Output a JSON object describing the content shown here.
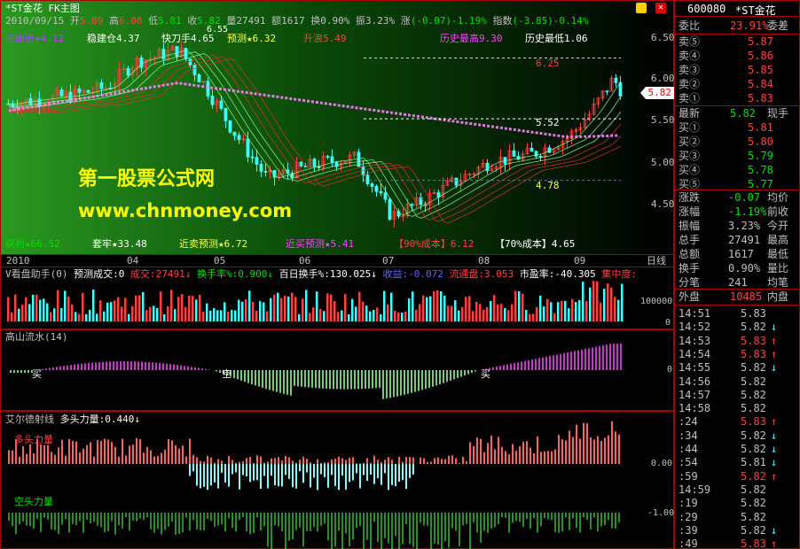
{
  "header": {
    "stock_name": "*ST金花",
    "chart_type": "FK主图",
    "date": "2010/09/15",
    "open_label": "开",
    "open": "5.89",
    "high_label": "高",
    "high": "6.00",
    "low_label": "低",
    "low": "5.81",
    "close_label": "收",
    "close": "5.82",
    "volume_label": "量",
    "volume": "27491",
    "amount_label": "额",
    "amount": "1617",
    "turnover_label": "换",
    "turnover": "0.90%",
    "amplitude_label": "振",
    "amplitude": "3.23%",
    "change_label": "涨",
    "change": "(-0.07)-1.19%",
    "index_label": "指数",
    "index_change": "(-3.85)-0.14%"
  },
  "indicators_row": [
    {
      "text": "底出击★4.12",
      "color": "#b040ff"
    },
    {
      "text": "稳建仓4.37",
      "color": "#ffffff"
    },
    {
      "text": "快刀手4.65",
      "color": "#ffffff"
    },
    {
      "text": "预测★6.32",
      "color": "#ffff40"
    },
    {
      "text": "升浪5.49",
      "color": "#ff4040"
    },
    {
      "text": "历史最高9.30",
      "color": "#ff40ff"
    },
    {
      "text": "历史最低1.06",
      "color": "#ffffff"
    }
  ],
  "bottom_indicators": [
    {
      "text": "获利★66.52",
      "color": "#00e000"
    },
    {
      "text": "套牢★33.48",
      "color": "#ffffff"
    },
    {
      "text": "近卖预测★6.72",
      "color": "#ffff40"
    },
    {
      "text": "近买预测★5.41",
      "color": "#ff40ff"
    },
    {
      "text": "【90%成本】6.12",
      "color": "#ff4040"
    },
    {
      "text": "【70%成本】4.65",
      "color": "#ffffff"
    }
  ],
  "main_chart": {
    "price_ticks": [
      "6.50",
      "6.00",
      "5.50",
      "5.00",
      "4.50"
    ],
    "level_labels": [
      "6.25",
      "5.52",
      "4.78"
    ],
    "top_tick": "6.55",
    "current_price_tag": "5.82",
    "watermark_line1": "第一股票公式网",
    "watermark_line2": "www.chnmoney.com"
  },
  "time_axis": {
    "labels": [
      "2010",
      "04",
      "05",
      "06",
      "07",
      "08",
      "09"
    ],
    "period": "日线"
  },
  "volume_panel": {
    "title_parts": [
      {
        "text": "V看盘助手(0)",
        "color": "#c0c0c0"
      },
      {
        "text": "预测成交:0",
        "color": "#ffffff"
      },
      {
        "text": "成交:27491↓",
        "color": "#ff4040"
      },
      {
        "text": "换手率%:0.900↓",
        "color": "#00e000"
      },
      {
        "text": "百日换手%:130.025↓",
        "color": "#ffffff"
      },
      {
        "text": "收益:-0.072",
        "color": "#6060ff"
      },
      {
        "text": "流通盘:3.053",
        "color": "#ff4040"
      },
      {
        "text": "市盈率:-40.305",
        "color": "#ffffff"
      },
      {
        "text": "集中度:",
        "color": "#ff4040"
      }
    ],
    "ticks": [
      "100000",
      "0"
    ]
  },
  "gaoshan_panel": {
    "title": "高山流水(14)",
    "labels": [
      "买",
      "空",
      "买"
    ],
    "tick": "0"
  },
  "elder_panel": {
    "title": "艾尔德射线",
    "value_label": "多头力量:0.440↓",
    "bull_label": "多头力量",
    "bear_label": "空头力量",
    "ticks": [
      "0.00",
      "-1.00"
    ]
  },
  "side_panel": {
    "code": "600080",
    "name": "*ST金花",
    "weibi_label": "委比",
    "weibi": "23.91%",
    "weicha_label": "委差",
    "sell_levels": [
      {
        "label": "卖⑤",
        "price": "5.87"
      },
      {
        "label": "卖④",
        "price": "5.86"
      },
      {
        "label": "卖③",
        "price": "5.85"
      },
      {
        "label": "卖②",
        "price": "5.84"
      },
      {
        "label": "卖①",
        "price": "5.83"
      }
    ],
    "latest_label": "最新",
    "latest": "5.82",
    "xianshou_label": "现手",
    "buy_levels": [
      {
        "label": "买①",
        "price": "5.81"
      },
      {
        "label": "买②",
        "price": "5.80"
      },
      {
        "label": "买③",
        "price": "5.79"
      },
      {
        "label": "买④",
        "price": "5.78"
      },
      {
        "label": "买⑤",
        "price": "5.77"
      }
    ],
    "stats": [
      {
        "label": "涨跌",
        "value": "-0.07",
        "right": "均价",
        "vcolor": "#00e000"
      },
      {
        "label": "涨幅",
        "value": "-1.19%",
        "right": "前收",
        "vcolor": "#00e000"
      },
      {
        "label": "振幅",
        "value": "3.23%",
        "right": "今开",
        "vcolor": "#c0c0c0"
      },
      {
        "label": "总手",
        "value": "27491",
        "right": "最高",
        "vcolor": "#c0c0c0"
      },
      {
        "label": "总额",
        "value": "1617",
        "right": "最低",
        "vcolor": "#c0c0c0"
      },
      {
        "label": "换手",
        "value": "0.90%",
        "right": "量比",
        "vcolor": "#c0c0c0"
      },
      {
        "label": "分笔",
        "value": "241",
        "right": "均笔",
        "vcolor": "#c0c0c0"
      }
    ],
    "waipan_label": "外盘",
    "waipan": "10485",
    "neipan_label": "内盘",
    "ticks": [
      {
        "time": "14:51",
        "price": "5.83",
        "arrow": ""
      },
      {
        "time": "14:52",
        "price": "5.82",
        "arrow": "↓"
      },
      {
        "time": "14:53",
        "price": "5.83",
        "arrow": "↑"
      },
      {
        "time": "14:54",
        "price": "5.83",
        "arrow": "↑"
      },
      {
        "time": "14:55",
        "price": "5.82",
        "arrow": "↓"
      },
      {
        "time": "14:56",
        "price": "5.82",
        "arrow": ""
      },
      {
        "time": "14:57",
        "price": "5.82",
        "arrow": ""
      },
      {
        "time": "14:58",
        "price": "5.82",
        "arrow": ""
      },
      {
        "time": ":24",
        "price": "5.83",
        "arrow": "↑"
      },
      {
        "time": ":34",
        "price": "5.82",
        "arrow": "↓"
      },
      {
        "time": ":44",
        "price": "5.82",
        "arrow": "↓"
      },
      {
        "time": ":54",
        "price": "5.81",
        "arrow": "↓"
      },
      {
        "time": ":59",
        "price": "5.82",
        "arrow": "↑"
      },
      {
        "time": "14:59",
        "price": "5.82",
        "arrow": ""
      },
      {
        "time": ":19",
        "price": "5.82",
        "arrow": ""
      },
      {
        "time": ":29",
        "price": "5.82",
        "arrow": ""
      },
      {
        "time": ":39",
        "price": "5.82",
        "arrow": "↓"
      },
      {
        "time": ":49",
        "price": "5.83",
        "arrow": "↑"
      }
    ]
  },
  "colors": {
    "up": "#ff4040",
    "down": "#40ffff",
    "grid": "#a00000",
    "bull": "#ff6060",
    "bear": "#80ffff",
    "green": "#00e000"
  }
}
